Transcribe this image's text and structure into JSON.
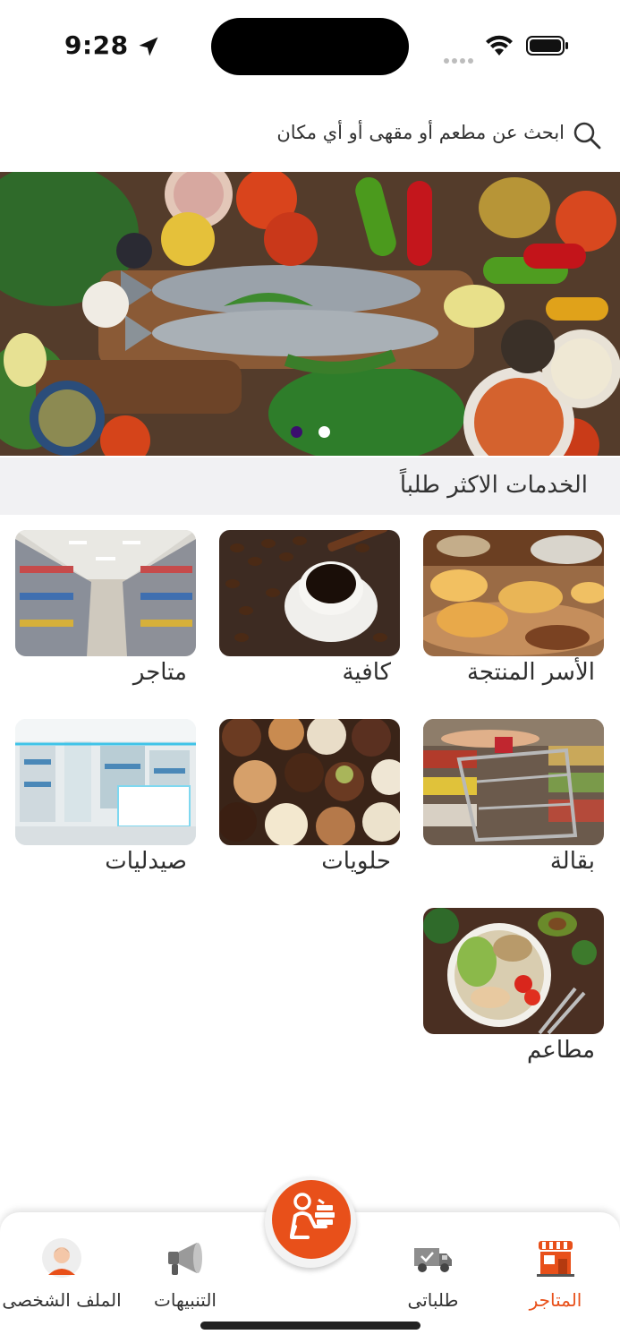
{
  "status_bar": {
    "time": "9:28"
  },
  "search": {
    "placeholder": "ابحث عن مطعم أو مقهى أو أي مكان"
  },
  "banner": {
    "slide_count": 2,
    "active_slide": 1
  },
  "section": {
    "title": "الخدمات الاكثر طلباً"
  },
  "categories": [
    {
      "label": "الأسر المنتجة",
      "image": "pastries-photo"
    },
    {
      "label": "كافية",
      "image": "coffee-photo"
    },
    {
      "label": "متاجر",
      "image": "supermarket-aisle-photo"
    },
    {
      "label": "بقالة",
      "image": "grocery-cart-photo"
    },
    {
      "label": "حلويات",
      "image": "chocolates-photo"
    },
    {
      "label": "صيدليات",
      "image": "pharmacy-photo"
    },
    {
      "label": "مطاعم",
      "image": "salad-bowl-photo"
    }
  ],
  "nav": {
    "items": [
      {
        "label": "المتاجر",
        "icon": "store-icon",
        "active": true
      },
      {
        "label": "طلباتى",
        "icon": "truck-icon",
        "active": false
      },
      {
        "label": "التنبيهات",
        "icon": "megaphone-icon",
        "active": false
      },
      {
        "label": "الملف الشخصى",
        "icon": "avatar-icon",
        "active": false
      }
    ],
    "center_icon": "delivery-person-icon"
  },
  "colors": {
    "accent": "#e8501a",
    "section_bg": "#f1f1f3",
    "dot_active": "#3b0f6e"
  }
}
